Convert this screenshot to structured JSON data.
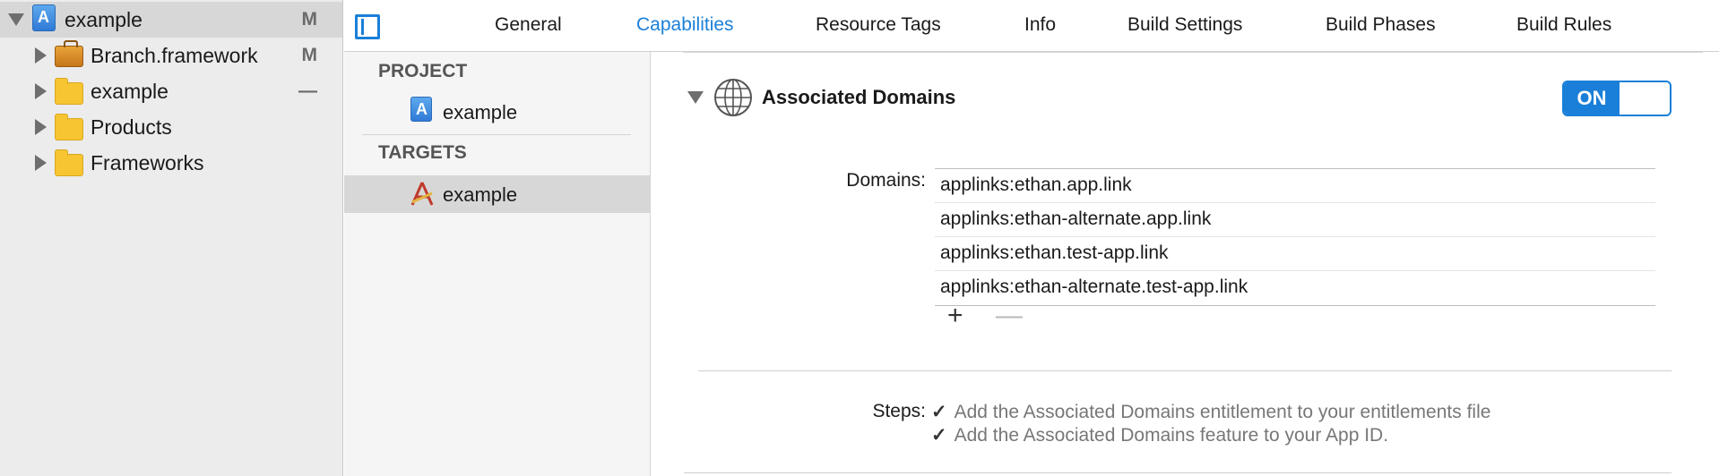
{
  "navigator": {
    "items": [
      {
        "label": "example",
        "badge": "M"
      },
      {
        "label": "Branch.framework",
        "badge": "M"
      },
      {
        "label": "example",
        "badge": "—"
      },
      {
        "label": "Products",
        "badge": ""
      },
      {
        "label": "Frameworks",
        "badge": ""
      }
    ]
  },
  "tabs": [
    "General",
    "Capabilities",
    "Resource Tags",
    "Info",
    "Build Settings",
    "Build Phases",
    "Build Rules"
  ],
  "active_tab": "Capabilities",
  "project_targets": {
    "project_header": "PROJECT",
    "project_item": "example",
    "targets_header": "TARGETS",
    "target_item": "example"
  },
  "capability": {
    "title": "Associated Domains",
    "toggle_label": "ON",
    "domains_label": "Domains:",
    "domains": [
      "applinks:ethan.app.link",
      "applinks:ethan-alternate.app.link",
      "applinks:ethan.test-app.link",
      "applinks:ethan-alternate.test-app.link"
    ],
    "add_glyph": "+",
    "remove_glyph": "—",
    "steps_label": "Steps:",
    "check_glyph": "✓",
    "steps": [
      "Add the Associated Domains entitlement to your entitlements file",
      "Add the Associated Domains feature to your App ID."
    ]
  },
  "colors": {
    "accent": "#1a7fd8",
    "sidebar_bg": "#ececec",
    "selection": "#d7d7d7"
  },
  "icons": [
    "xcode-project-icon",
    "framework-icon",
    "folder-icon",
    "globe-icon",
    "target-icon",
    "sidebar-toggle-icon"
  ]
}
